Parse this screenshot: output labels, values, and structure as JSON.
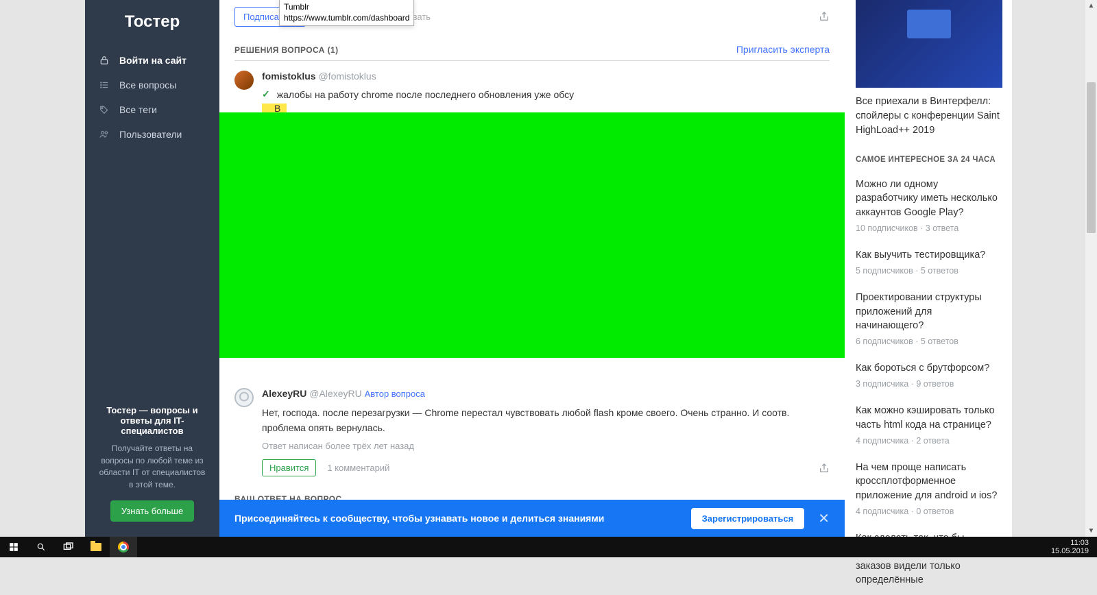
{
  "brand": "Тостер",
  "tooltip": {
    "title": "Tumblr",
    "url": "https://www.tumblr.com/dashboard"
  },
  "sidebar": {
    "login": "Войти на сайт",
    "items": [
      {
        "label": "Все вопросы"
      },
      {
        "label": "Все теги"
      },
      {
        "label": "Пользователи"
      }
    ],
    "footer": {
      "tagline": "Тостер — вопросы и ответы для IT-специалистов",
      "desc": "Получайте ответы на вопросы по любой теме из области IT от специалистов в этой теме.",
      "more": "Узнать больше"
    }
  },
  "actions": {
    "subscribe": "Подписаться",
    "ghost": "ировать"
  },
  "solutions": {
    "title": "РЕШЕНИЯ ВОПРОСА",
    "count": "(1)",
    "invite": "Пригласить эксперта"
  },
  "ans1": {
    "name": "fomistoklus",
    "handle": "@fomistoklus",
    "text": "жалобы на работу chrome после последнего обновления уже обсу",
    "extra": "В"
  },
  "ans2": {
    "name": "AlexeyRU",
    "handle": "@AlexeyRU",
    "badge": "Автор вопроса",
    "text": "Нет, господа. после перезагрузки — Chrome перестал чувствовать любой flash кроме своего. Очень странно. И соотв. проблема опять вернулась.",
    "meta": "Ответ написан более трёх лет назад",
    "like": "Нравится",
    "comment": "1 комментарий"
  },
  "your_answer": "ВАШ ОТВЕТ НА ВОПРОС",
  "join": {
    "text": "Присоединяйтесь к сообществу, чтобы узнавать новое и делиться знаниями",
    "register": "Зарегистрироваться"
  },
  "promo": {
    "text": "Все приехали в Винтерфелл: спойлеры с конференции Saint HighLoad++ 2019"
  },
  "interesting": {
    "title": "САМОЕ ИНТЕРЕСНОЕ ЗА 24 ЧАСА",
    "items": [
      {
        "q": "Можно ли одному разработчику иметь несколько аккаунтов Google Play?",
        "m": "10 подписчиков · 3 ответа"
      },
      {
        "q": "Как выучить тестировщика?",
        "m": "5 подписчиков · 5 ответов"
      },
      {
        "q": "Проектировании структуры приложений для начинающего?",
        "m": "6 подписчиков · 5 ответов"
      },
      {
        "q": "Как бороться с брутфорсом?",
        "m": "3 подписчика · 9 ответов"
      },
      {
        "q": "Как можно кэшировать только часть html кода на странице?",
        "m": "4 подписчика · 2 ответа"
      },
      {
        "q": "На чем проще написать кроссплотформенное приложение для android и ios?",
        "m": "4 подписчика · 0 ответов"
      },
      {
        "q": "Как сделать так, что бы определённой категории заказов видели только определённые",
        "m": ""
      }
    ]
  },
  "taskbar": {
    "time": "11:03",
    "date": "15.05.2019"
  }
}
